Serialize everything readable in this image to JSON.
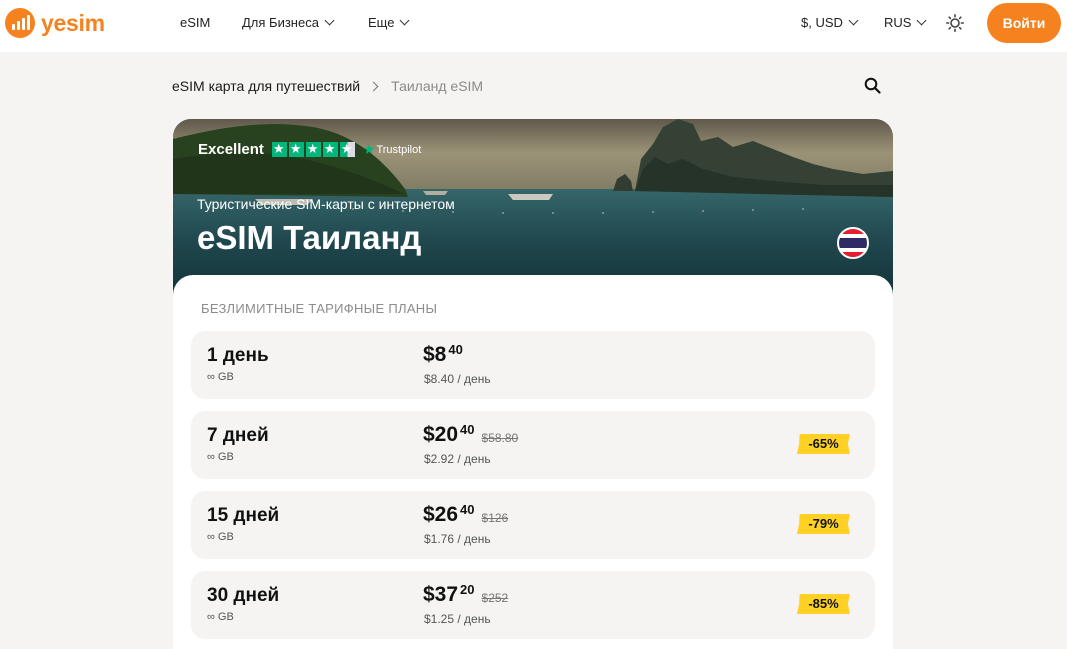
{
  "header": {
    "logo_text": "yesim",
    "nav": [
      {
        "label": "eSIM",
        "has_dropdown": false
      },
      {
        "label": "Для Бизнеса",
        "has_dropdown": true
      },
      {
        "label": "Еще",
        "has_dropdown": true
      }
    ],
    "currency": "$, USD",
    "language": "RUS",
    "theme_icon": "sun-icon",
    "login_label": "Войти"
  },
  "breadcrumb": {
    "items": [
      "eSIM карта для путешествий",
      "Таиланд eSIM"
    ],
    "search_icon": "search-icon"
  },
  "hero": {
    "trustpilot_rating_word": "Excellent",
    "trustpilot_stars": 4.5,
    "trustpilot_brand": "Trustpilot",
    "subtitle": "Туристические SIM-карты с интернетом",
    "title": "eSIM Таиланд",
    "flag": "thailand-flag"
  },
  "plans": {
    "section_title": "БЕЗЛИМИТНЫЕ ТАРИФНЫЕ ПЛАНЫ",
    "items": [
      {
        "name": "1 день",
        "data": "∞ GB",
        "price_main": "$8",
        "price_cents": "40",
        "old_price": "",
        "per_day": "$8.40 / день",
        "discount": ""
      },
      {
        "name": "7 дней",
        "data": "∞ GB",
        "price_main": "$20",
        "price_cents": "40",
        "old_price": "$58.80",
        "per_day": "$2.92 / день",
        "discount": "-65%"
      },
      {
        "name": "15 дней",
        "data": "∞ GB",
        "price_main": "$26",
        "price_cents": "40",
        "old_price": "$126",
        "per_day": "$1.76 / день",
        "discount": "-79%"
      },
      {
        "name": "30 дней",
        "data": "∞ GB",
        "price_main": "$37",
        "price_cents": "20",
        "old_price": "$252",
        "per_day": "$1.25 / день",
        "discount": "-85%"
      }
    ]
  },
  "colors": {
    "brand_orange": "#f5821f",
    "trustpilot_green": "#00b67a",
    "discount_yellow": "#ffd124",
    "page_bg": "#f5f4f2"
  }
}
